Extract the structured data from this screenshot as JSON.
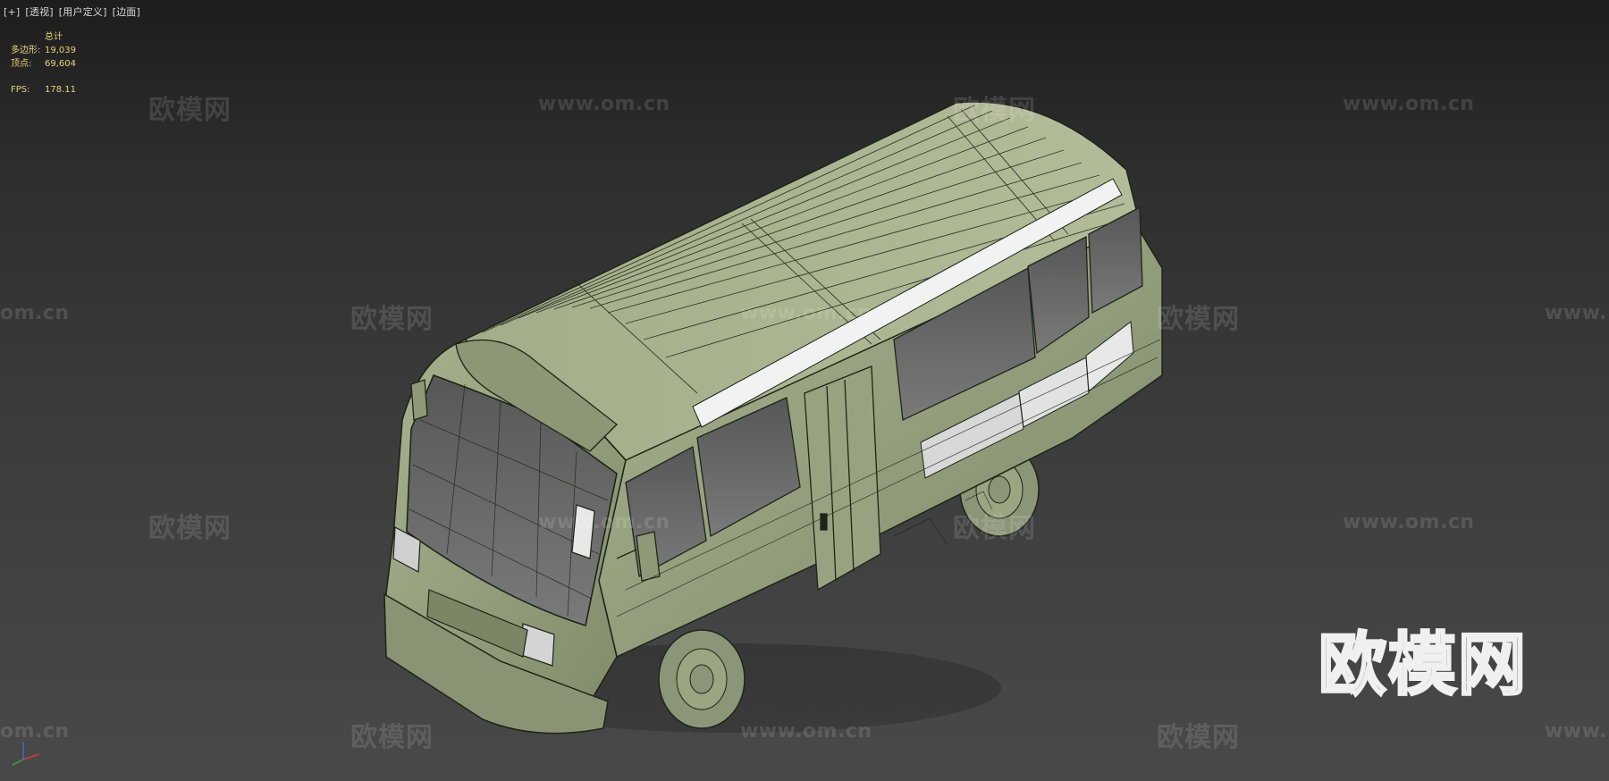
{
  "viewport": {
    "menu": [
      "[+]",
      "[透视]",
      "[用户定义]",
      "[边面]"
    ]
  },
  "stats": {
    "header": "总计",
    "polygons_label": "多边形:",
    "polygons_value": "19,039",
    "vertices_label": "顶点:",
    "vertices_value": "69,604",
    "fps_label": "FPS:",
    "fps_value": "178.11"
  },
  "watermark": {
    "logo_text": "欧模网",
    "url_text": "www.om.cn",
    "partial_url_left": "om.cn",
    "partial_url_right": "www."
  },
  "colors": {
    "body": "#9aa582",
    "wire": "#1e2418",
    "glass": "#6b6b6b",
    "stripe": "#f2f2f2",
    "stats_text": "#e6d47a"
  }
}
